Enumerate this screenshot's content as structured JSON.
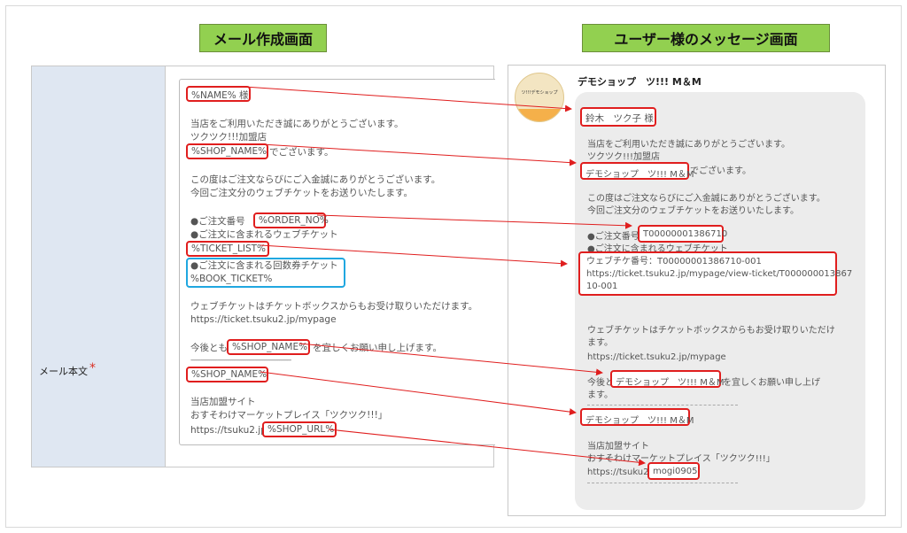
{
  "headings": {
    "left": "メール作成画面",
    "right": "ユーザー様のメッセージ画面"
  },
  "form": {
    "label": "メール本文",
    "required_mark": "*",
    "lines": {
      "name_tag": "%NAME% 様",
      "thanks": "当店をご利用いただき誠にありがとうございます。",
      "store": "ツクツク!!!加盟店",
      "shop_name_tag": "%SHOP_NAME%",
      "shop_suffix": "でございます。",
      "order_thanks": "この度はご注文ならびにご入金誠にありがとうございます。",
      "send_tickets": "今回ご注文分のウェブチケットをお送りいたします。",
      "order_no_label": "●ご注文番号",
      "order_no_tag": "%ORDER_NO%",
      "ticket_label": "●ご注文に含まれるウェブチケット",
      "ticket_list_tag": "%TICKET_LIST%",
      "book_label": "●ご注文に含まれる回数券チケット",
      "book_tag": "%BOOK_TICKET%",
      "receive": "ウェブチケットはチケットボックスからもお受け取りいただけます。",
      "mypage_url": "https://ticket.tsuku2.jp/mypage",
      "closing_prefix": "今後とも",
      "closing_suffix": "を宜しくお願い申し上げます。",
      "divider": "------------------------------------------------------------",
      "footer_shop_tag": "%SHOP_NAME%",
      "site_label": "当店加盟サイト",
      "marketplace": "おすそわけマーケットプレイス「ツクツク!!!」",
      "url_prefix": "https://tsuku2.jp/",
      "shop_url_tag": "%SHOP_URL%"
    }
  },
  "message": {
    "shop_name": "デモショップ　ツ!!! M＆M",
    "avatar_text": "ツ!!!デモショップ",
    "lines": {
      "name": "鈴木　ツク子 様",
      "thanks": "当店をご利用いただき誠にありがとうございます。",
      "store": "ツクツク!!!加盟店",
      "shop_name": "デモショップ　ツ!!! M＆M",
      "shop_suffix": "でございます。",
      "order_thanks": "この度はご注文ならびにご入金誠にありがとうございます。",
      "send_tickets": "今回ご注文分のウェブチケットをお送りいたします。",
      "order_no_label": "●ご注文番号：",
      "order_no": "T00000001386710",
      "ticket_label": "●ご注文に含まれるウェブチケット",
      "ticket_line1": "ウェブチケ番号：T00000001386710-001",
      "ticket_line2": "https://ticket.tsuku2.jp/mypage/view-ticket/T000000013867",
      "ticket_line3": "10-001",
      "receive1": "ウェブチケットはチケットボックスからもお受け取りいただけ",
      "receive2": "ます。",
      "mypage_url": "https://ticket.tsuku2.jp/mypage",
      "closing_prefix": "今後と",
      "closing_shop": "デモショップ　ツ!!! M＆M",
      "closing_suffix": "を宜しくお願い申し上げ",
      "closing_suffix2": "ます。",
      "footer_shop": "デモショップ　ツ!!! M＆M",
      "site_label": "当店加盟サイト",
      "marketplace": "おすそわけマーケットプレイス「ツクツク!!!」",
      "url_prefix": "https://tsuku2.jp/",
      "shop_url": "mogi0905"
    }
  },
  "colors": {
    "heading_bg": "#92d050",
    "highlight": "#e01e1e",
    "highlight_blue": "#20a7e0",
    "label_bg": "#dfe7f2",
    "bubble_bg": "#ececec"
  }
}
